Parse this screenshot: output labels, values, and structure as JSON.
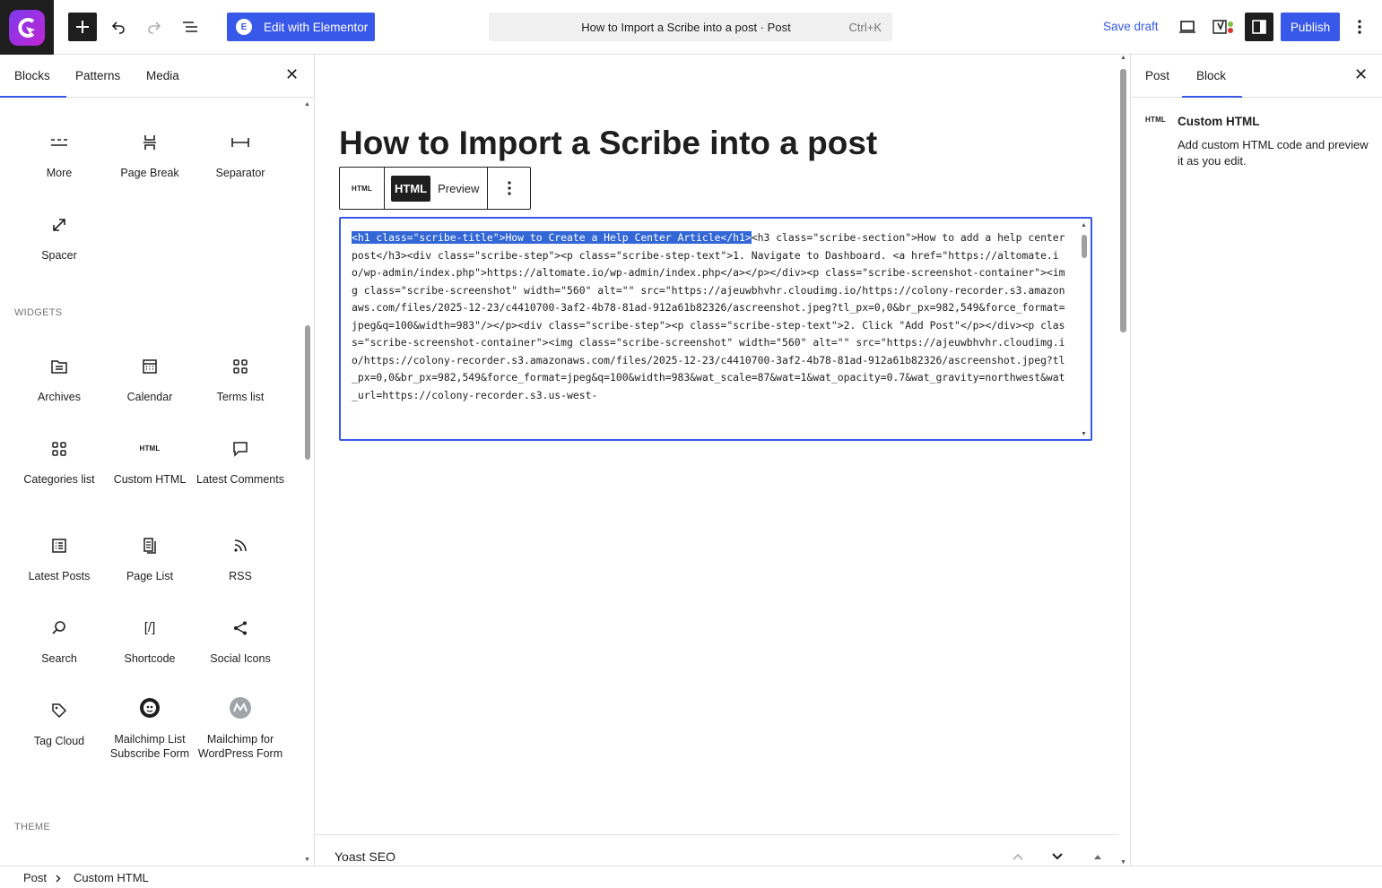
{
  "header": {
    "elementor_label": "Edit with Elementor",
    "command_title": "How to Import a Scribe into a post · Post",
    "command_shortcut": "Ctrl+K",
    "save_draft": "Save draft",
    "publish": "Publish"
  },
  "inserter": {
    "tabs": [
      "Blocks",
      "Patterns",
      "Media"
    ],
    "sections": {
      "widgets": "WIDGETS",
      "theme": "THEME"
    },
    "blocks": {
      "more": "More",
      "page_break": "Page Break",
      "separator": "Separator",
      "spacer": "Spacer",
      "archives": "Archives",
      "calendar": "Calendar",
      "terms_list": "Terms list",
      "categories_list": "Categories list",
      "custom_html": "Custom HTML",
      "latest_comments": "Latest Comments",
      "latest_posts": "Latest Posts",
      "page_list": "Page List",
      "rss": "RSS",
      "search": "Search",
      "shortcode": "Shortcode",
      "social_icons": "Social Icons",
      "tag_cloud": "Tag Cloud",
      "mailchimp_list": "Mailchimp List Subscribe Form",
      "mailchimp_wp": "Mailchimp for WordPress Form"
    },
    "icons": {
      "html_small": "HTML",
      "shortcode_glyph": "[/]"
    }
  },
  "editor": {
    "post_title": "How to Import a Scribe into a post",
    "toolbar": {
      "block_icon": "HTML",
      "html_tab": "HTML",
      "preview_tab": "Preview"
    },
    "code_selected": "<h1 class=\"scribe-title\">How to Create a Help Center Article</h1>",
    "code_rest": "<h3 class=\"scribe-section\">How to add a help center post</h3><div class=\"scribe-step\"><p class=\"scribe-step-text\">1. Navigate to Dashboard. <a href=\"https://altomate.io/wp-admin/index.php\">https://altomate.io/wp-admin/index.php</a></p></div><p class=\"scribe-screenshot-container\"><img class=\"scribe-screenshot\" width=\"560\" alt=\"\" src=\"https://ajeuwbhvhr.cloudimg.io/https://colony-recorder.s3.amazonaws.com/files/2025-12-23/c4410700-3af2-4b78-81ad-912a61b82326/ascreenshot.jpeg?tl_px=0,0&br_px=982,549&force_format=jpeg&q=100&width=983\"/></p><div class=\"scribe-step\"><p class=\"scribe-step-text\">2. Click \"Add Post\"</p></div><p class=\"scribe-screenshot-container\"><img class=\"scribe-screenshot\" width=\"560\" alt=\"\" src=\"https://ajeuwbhvhr.cloudimg.io/https://colony-recorder.s3.amazonaws.com/files/2025-12-23/c4410700-3af2-4b78-81ad-912a61b82326/ascreenshot.jpeg?tl_px=0,0&br_px=982,549&force_format=jpeg&q=100&width=983&wat_scale=87&wat=1&wat_opacity=0.7&wat_gravity=northwest&wat_url=https://colony-recorder.s3.us-west-",
    "yoast_label": "Yoast SEO"
  },
  "settings": {
    "tabs": [
      "Post",
      "Block"
    ],
    "block_icon": "HTML",
    "block_title": "Custom HTML",
    "block_description": "Add custom HTML code and preview it as you edit."
  },
  "breadcrumb": {
    "root": "Post",
    "current": "Custom HTML"
  },
  "colors": {
    "accent": "#3858e9",
    "dark": "#1e1e1e",
    "selection": "#3367d6"
  }
}
